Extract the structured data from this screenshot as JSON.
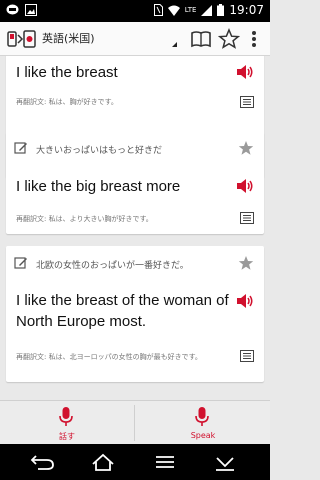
{
  "status_bar": {
    "time": "19:07",
    "network": "LTE",
    "icons": [
      "line-app-icon",
      "image-icon",
      "sim-icon",
      "wifi-icon",
      "signal-icon",
      "battery-icon"
    ]
  },
  "app_bar": {
    "language": "英語(米国)",
    "icons": [
      "book-icon",
      "star-outline-icon",
      "overflow-menu-icon"
    ]
  },
  "cards": [
    {
      "source": "",
      "translation": "I like the breast",
      "back_translation": "再翻訳文: 私は、胸が好きです。"
    },
    {
      "source": "大きいおっぱいはもっと好きだ",
      "translation": "I like the big breast more",
      "back_translation": "再翻訳文: 私は、より大きい胸が好きです。"
    },
    {
      "source": "北欧の女性のおっぱいが一番好きだ。",
      "translation_lines": [
        "I like the breast of the woman of",
        "North Europe most."
      ],
      "back_translation": "再翻訳文: 私は、北ヨーロッパの女性の胸が最も好きです。"
    }
  ],
  "bottom": {
    "speak_ja": "話す",
    "speak_en": "Speak"
  },
  "colors": {
    "accent": "#d1112e",
    "status_bar": "#000000",
    "background": "#e9e9e9"
  }
}
